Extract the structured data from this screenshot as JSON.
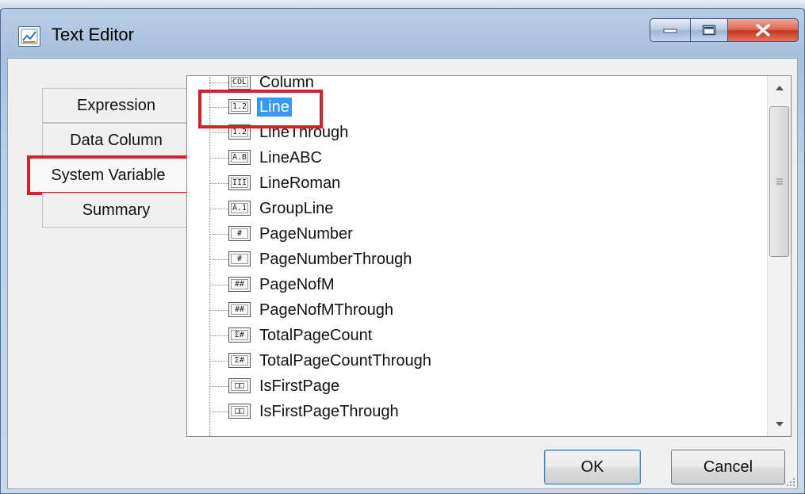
{
  "window": {
    "title": "Text Editor",
    "icon": "text-editor-icon",
    "controls": {
      "minimize": "minimize-icon",
      "maximize": "maximize-icon",
      "close": "close-icon"
    }
  },
  "tabs": [
    {
      "label": "Expression",
      "selected": false
    },
    {
      "label": "Data Column",
      "selected": false
    },
    {
      "label": "System Variable",
      "selected": true,
      "highlighted": true
    },
    {
      "label": "Summary",
      "selected": false
    }
  ],
  "tree": {
    "items": [
      {
        "label": "Column",
        "glyph": "COL",
        "partial": true
      },
      {
        "label": "Line",
        "glyph": "1.2",
        "selected": true,
        "highlighted": true
      },
      {
        "label": "LineThrough",
        "glyph": "1.2"
      },
      {
        "label": "LineABC",
        "glyph": "A.B"
      },
      {
        "label": "LineRoman",
        "glyph": "III"
      },
      {
        "label": "GroupLine",
        "glyph": "A.1"
      },
      {
        "label": "PageNumber",
        "glyph": "#"
      },
      {
        "label": "PageNumberThrough",
        "glyph": "#"
      },
      {
        "label": "PageNofM",
        "glyph": "##"
      },
      {
        "label": "PageNofMThrough",
        "glyph": "##"
      },
      {
        "label": "TotalPageCount",
        "glyph": "Σ#"
      },
      {
        "label": "TotalPageCountThrough",
        "glyph": "Σ#"
      },
      {
        "label": "IsFirstPage",
        "glyph": "□□"
      },
      {
        "label": "IsFirstPageThrough",
        "glyph": "□□",
        "partial": true
      }
    ]
  },
  "buttons": {
    "ok": "OK",
    "cancel": "Cancel"
  },
  "colors": {
    "highlight_border": "#d42029",
    "selection": "#3399ff"
  }
}
